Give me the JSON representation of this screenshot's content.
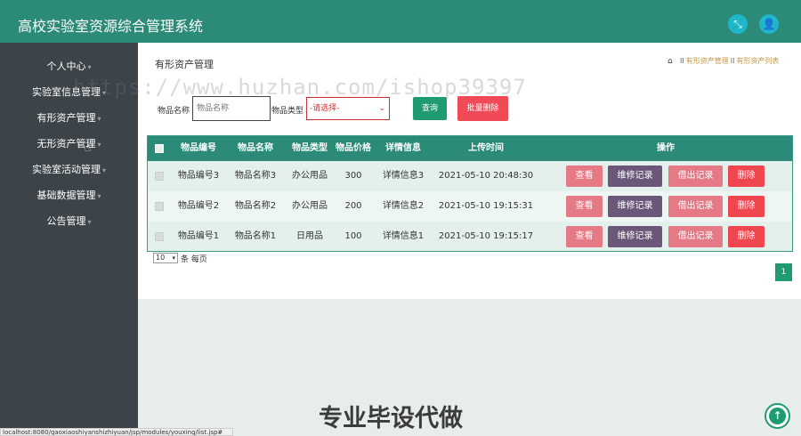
{
  "app": {
    "title": "高校实验室资源综合管理系统"
  },
  "header": {
    "expand_icon": "expand-icon",
    "user_icon": "user-icon"
  },
  "sidebar": {
    "items": [
      {
        "label": "个人中心"
      },
      {
        "label": "实验室信息管理"
      },
      {
        "label": "有形资产管理"
      },
      {
        "label": "无形资产管理"
      },
      {
        "label": "实验室活动管理"
      },
      {
        "label": "基础数据管理"
      },
      {
        "label": "公告管理"
      }
    ]
  },
  "page": {
    "title": "有形资产管理",
    "breadcrumb": {
      "home_icon": "home-icon",
      "sep": "II",
      "item1": "有形资产管理",
      "item2": "有形资产列表"
    }
  },
  "search": {
    "name_label": "物品名称",
    "name_placeholder": "物品名称",
    "type_label": "物品类型",
    "type_value": "-请选择-",
    "query_label": "查询",
    "batch_delete_label": "批量删除"
  },
  "table": {
    "headers": [
      "物品编号",
      "物品名称",
      "物品类型",
      "物品价格",
      "详情信息",
      "上传时间",
      "操作"
    ],
    "rows": [
      {
        "code": "物品编号3",
        "name": "物品名称3",
        "type": "办公用品",
        "price": "300",
        "detail": "详情信息3",
        "time": "2021-05-10 20:48:30"
      },
      {
        "code": "物品编号2",
        "name": "物品名称2",
        "type": "办公用品",
        "price": "200",
        "detail": "详情信息2",
        "time": "2021-05-10 19:15:31"
      },
      {
        "code": "物品编号1",
        "name": "物品名称1",
        "type": "日用品",
        "price": "100",
        "detail": "详情信息1",
        "time": "2021-05-10 19:15:17"
      }
    ],
    "actions": {
      "view": "查看",
      "repair": "维修记录",
      "lend": "借出记录",
      "delete": "删除"
    }
  },
  "pager": {
    "page_size": "10",
    "page_size_label": "条 每页",
    "current_page": "1"
  },
  "watermark": {
    "url": "https://www.huzhan.com/ishop39397",
    "caption": "专业毕设代做"
  },
  "statusbar": {
    "url": "localhost:8080/gaoxiaoshiyanshizhiyuan/jsp/modules/youxing/list.jsp#"
  },
  "colors": {
    "primary": "#2c8a78",
    "sidebar": "#3d4449",
    "accent_green": "#1e9b6f",
    "danger": "#ef4a55",
    "pink": "#e57985",
    "purple": "#6b577a"
  }
}
